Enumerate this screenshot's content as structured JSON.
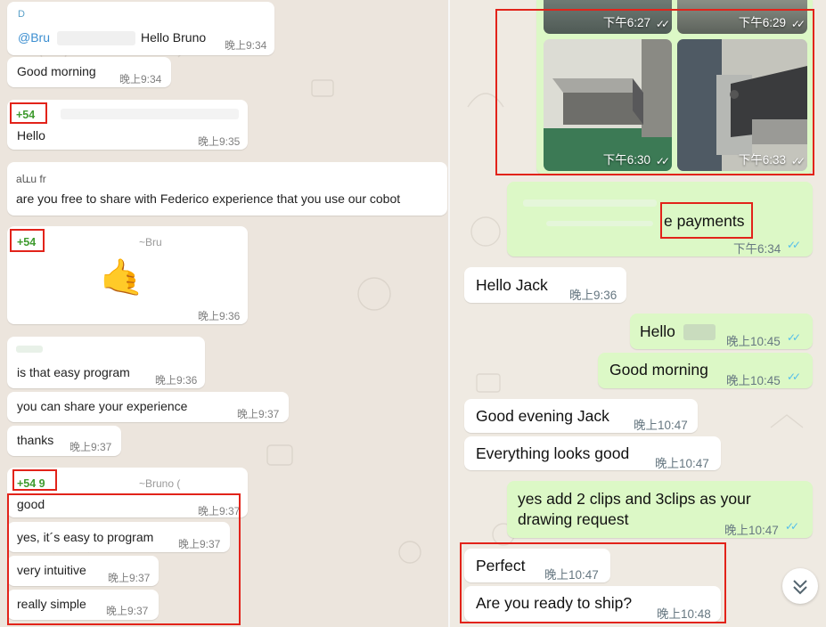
{
  "left": {
    "msg_hello_bruno": {
      "sender_top": "D",
      "mention": "@Bru",
      "text": "Hello Bruno",
      "time": "晚上9:34"
    },
    "msg_good_morning": {
      "text": "Good morning",
      "time": "晚上9:34"
    },
    "msg_hello": {
      "sender": "+54",
      "text": "Hello",
      "time": "晚上9:35"
    },
    "msg_free": {
      "sender_top": "aևu fr",
      "text": "are you free to share with Federico experience that you use our cobot"
    },
    "msg_emoji": {
      "sender": "+54",
      "name_hint": "~Bru",
      "emoji": "🤙",
      "time": "晚上9:36"
    },
    "msg_easy": {
      "text": "is that easy program",
      "time": "晚上9:36"
    },
    "msg_share": {
      "text": "you can share your experience",
      "time": "晚上9:37"
    },
    "msg_thanks": {
      "text": "thanks",
      "time": "晚上9:37"
    },
    "msg_good": {
      "sender": "+54 9",
      "name_hint": "~Bruno (",
      "text": "good",
      "time": "晚上9:37"
    },
    "msg_yes_easy": {
      "text": "yes, it´s easy to program",
      "time": "晚上9:37"
    },
    "msg_intuitive": {
      "text": "very intuitive",
      "time": "晚上9:37"
    },
    "msg_simple": {
      "text": "really simple",
      "time": "晚上9:37"
    }
  },
  "right": {
    "photos": [
      {
        "time": "下午6:27",
        "ticks": "✓✓"
      },
      {
        "time": "下午6:29",
        "ticks": "✓✓"
      },
      {
        "time": "下午6:30",
        "ticks": "✓✓"
      },
      {
        "time": "下午6:33",
        "ticks": "✓✓"
      }
    ],
    "msg_payments": {
      "text": "e payments",
      "time": "下午6:34",
      "ticks": "✓✓"
    },
    "msg_hello_jack": {
      "text": "Hello Jack",
      "time": "晚上9:36"
    },
    "msg_hello_out": {
      "text": "Hello",
      "time": "晚上10:45",
      "ticks": "✓✓"
    },
    "msg_good_morning_out": {
      "text": "Good morning",
      "time": "晚上10:45",
      "ticks": "✓✓"
    },
    "msg_good_evening": {
      "text": "Good evening Jack",
      "time": "晚上10:47"
    },
    "msg_looks_good": {
      "text": "Everything looks good",
      "time": "晚上10:47"
    },
    "msg_clips": {
      "line1": "yes add 2 clips and 3clips  as your",
      "line2": "drawing request",
      "time": "晚上10:47",
      "ticks": "✓✓"
    },
    "msg_perfect": {
      "text": "Perfect",
      "time": "晚上10:47"
    },
    "msg_ship": {
      "text": "Are you ready to ship?",
      "time": "晚上10:48"
    }
  },
  "colors": {
    "sender_green": "#3f9b2f",
    "highlight_red": "#e2231a",
    "outgoing_bubble": "#dcf8c6",
    "read_ticks": "#53bdeb"
  },
  "icons": {
    "scroll_down": "chevron-double-down-icon"
  }
}
